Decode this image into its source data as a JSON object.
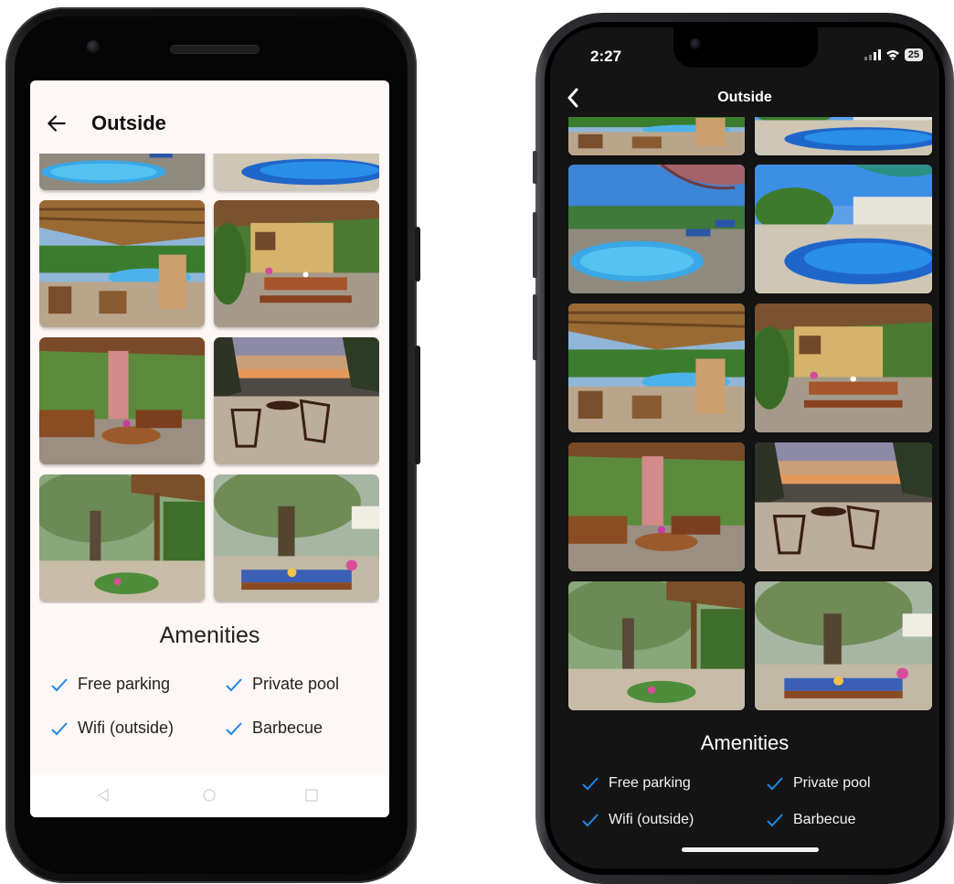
{
  "android": {
    "header": {
      "title": "Outside"
    },
    "amenities_title": "Amenities",
    "amenities": [
      {
        "label": "Free parking"
      },
      {
        "label": "Private pool"
      },
      {
        "label": "Wifi (outside)"
      },
      {
        "label": "Barbecue"
      }
    ]
  },
  "iphone": {
    "status": {
      "time": "2:27",
      "battery": "25"
    },
    "header": {
      "title": "Outside"
    },
    "amenities_title": "Amenities",
    "amenities": [
      {
        "label": "Free parking"
      },
      {
        "label": "Private pool"
      },
      {
        "label": "Wifi (outside)"
      },
      {
        "label": "Barbecue"
      }
    ]
  },
  "photos": [
    {
      "name": "pool-umbrellas"
    },
    {
      "name": "pool-garden"
    },
    {
      "name": "pergola-pool-view"
    },
    {
      "name": "patio-picnic-table"
    },
    {
      "name": "gazebo-table"
    },
    {
      "name": "sunset-terrace"
    },
    {
      "name": "olive-tree-pergola"
    },
    {
      "name": "olive-tree-dining"
    }
  ],
  "colors": {
    "check": "#1e88e5",
    "android_bg": "#fdf7f5",
    "ios_bg": "#141414"
  }
}
